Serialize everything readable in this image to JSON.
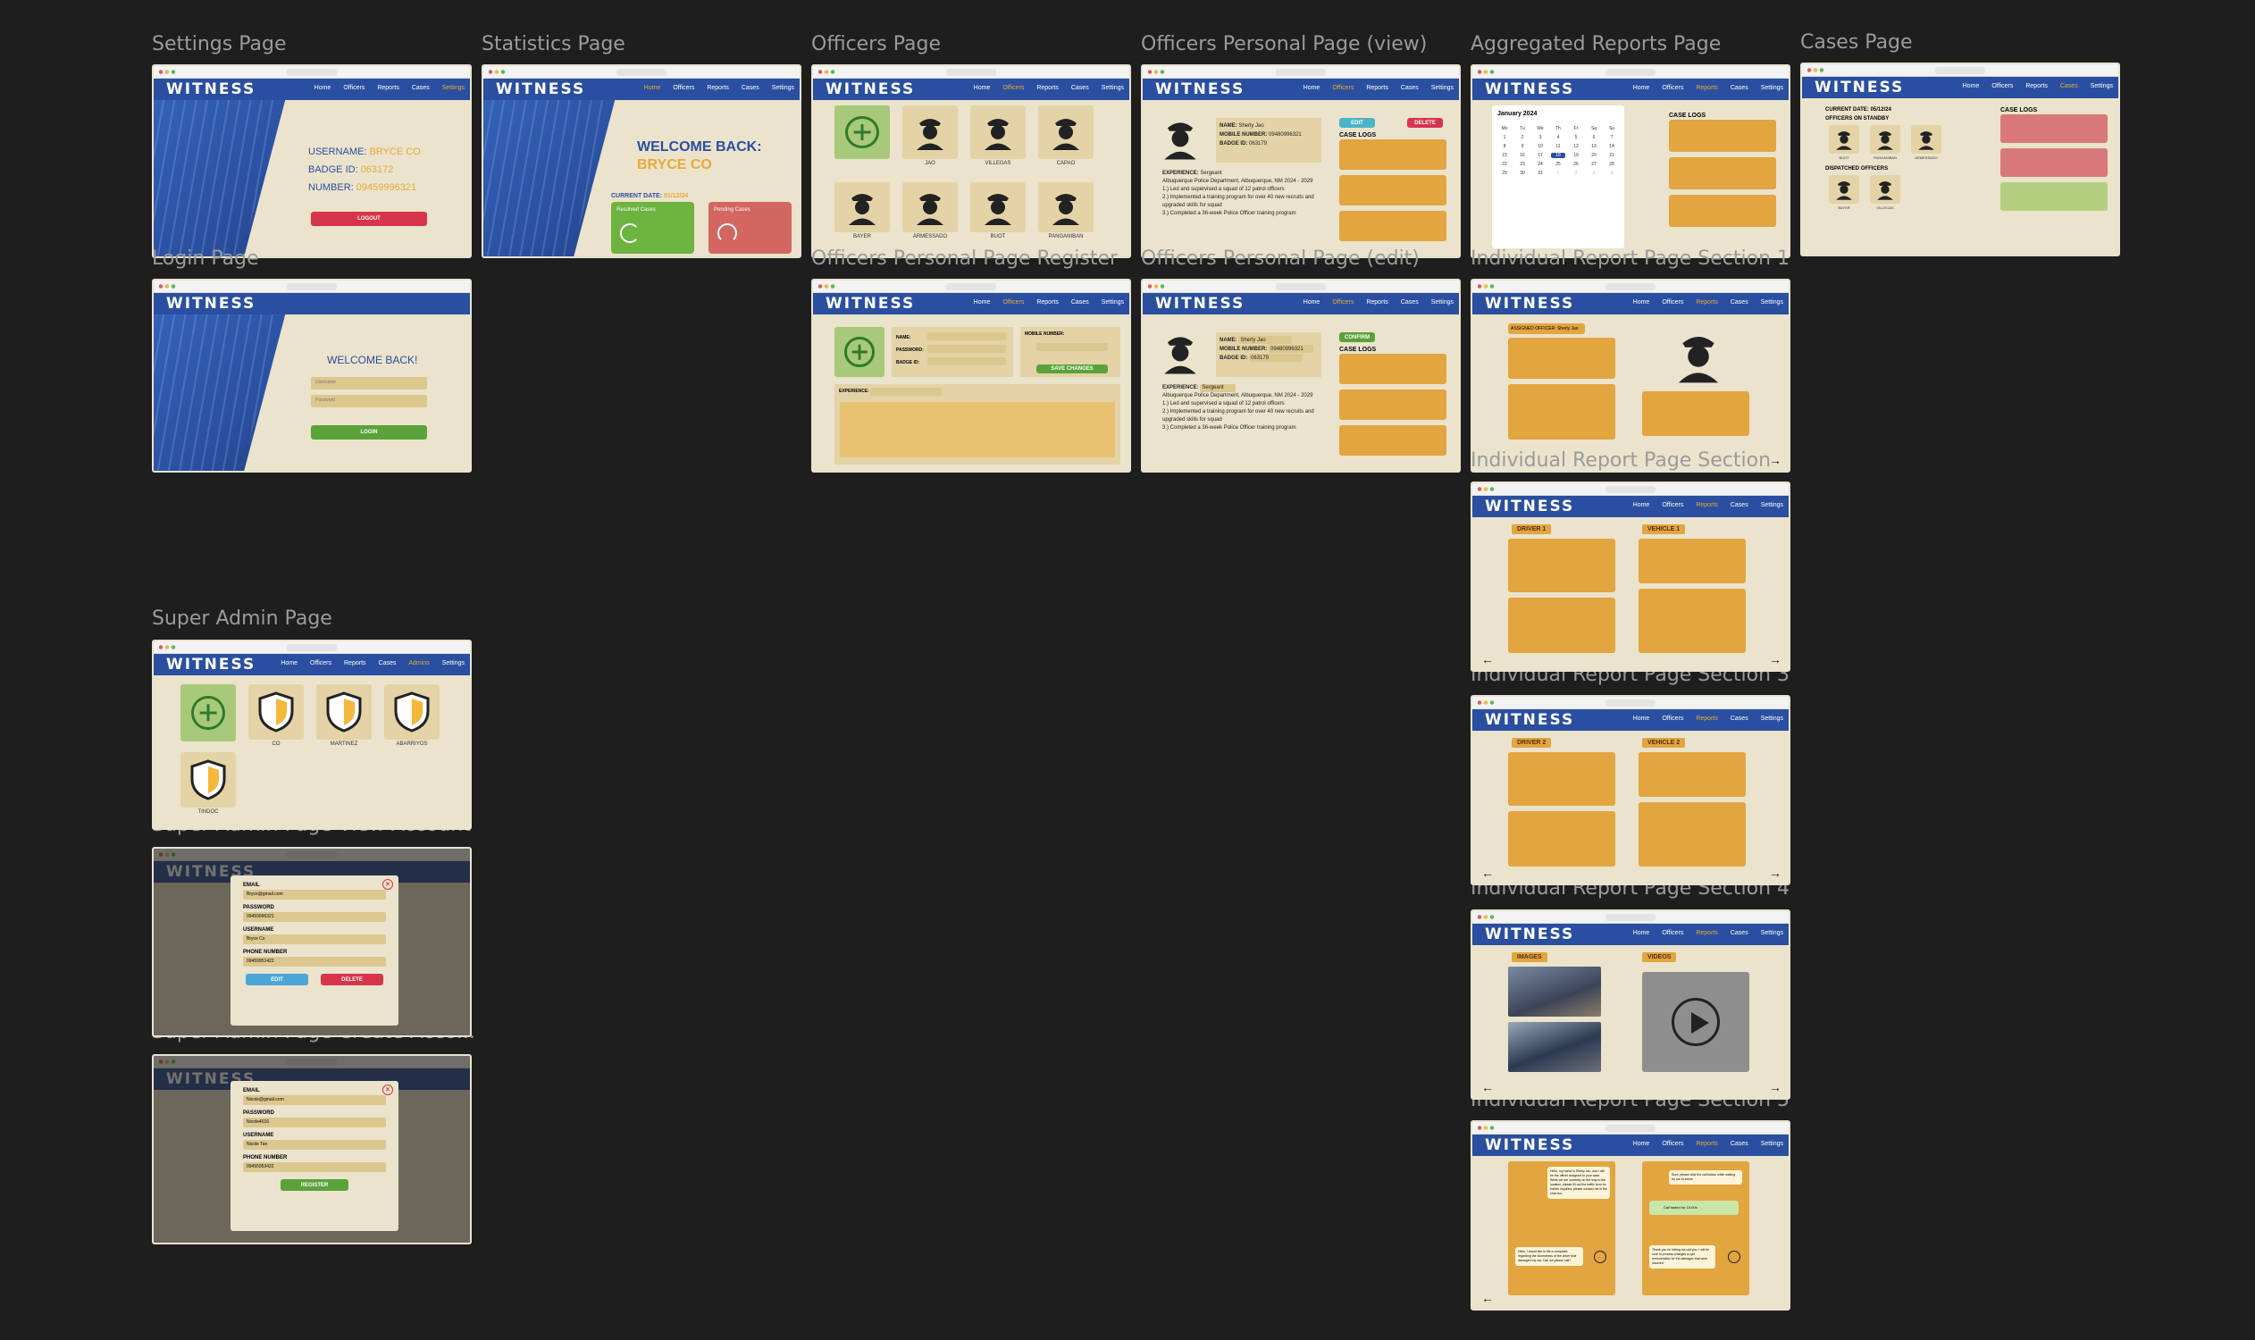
{
  "brand": {
    "logo": "WITNESS",
    "blue": "#2a4fa0",
    "accent": "#e9a93a",
    "beige": "#ebe3cc",
    "orange": "#e2a53f",
    "green": "#5aa23a",
    "red": "#d7354b"
  },
  "nav": {
    "home": "Home",
    "officers": "Officers",
    "reports": "Reports",
    "cases": "Cases",
    "settings": "Settings",
    "admins": "Admins"
  },
  "frames": {
    "settings": {
      "label": "Settings Page",
      "username_label": "USERNAME:",
      "username": "BRYCE CO",
      "badge_label": "BADGE ID:",
      "badge": "063172",
      "number_label": "NUMBER:",
      "number": "09459996321",
      "logout": "LOGOUT"
    },
    "statistics": {
      "label": "Statistics Page",
      "welcome": "WELCOME BACK:",
      "name": "BRYCE CO",
      "current_date_label": "CURRENT DATE:",
      "current_date": "01/12/24",
      "resolved": "Resolved Cases",
      "pending": "Pending Cases"
    },
    "officers": {
      "label": "Officers Page",
      "names": [
        "JAO",
        "VILLEGAS",
        "CAPAO",
        "BAYER",
        "ARMESSADO",
        "BUOT",
        "PANGANIBAN"
      ]
    },
    "officer_view": {
      "label": "Officers Personal Page (view)",
      "name_label": "NAME:",
      "name": "Sherly Jao",
      "mobile_label": "MOBILE NUMBER:",
      "mobile": "09480996321",
      "badge_label": "BADGE ID:",
      "badge": "063179",
      "edit": "EDIT",
      "delete": "DELETE",
      "case_logs": "CASE LOGS",
      "experience_label": "EXPERIENCE:",
      "rank": "Sergeant",
      "experience": "Albuquerque Police Department, Albuquerque, NM 2024 - 2029",
      "exp_lines": [
        "1.) Led and supervised a squad of 12 patrol officers",
        "2.) Implemented a training program for over 40 new recruits and upgraded skills for squad",
        "3.) Completed a 36-week Police Officer training program"
      ]
    },
    "aggregated": {
      "label": "Aggregated Reports Page",
      "month": "January 2024",
      "case_logs": "CASE LOGS",
      "selected_day": "18"
    },
    "cases": {
      "label": "Cases Page",
      "current_date_label": "CURRENT DATE:",
      "current_date": "05/12/24",
      "standby": "OFFICERS ON STANDBY",
      "dispatched": "DISPATCHED OFFICERS",
      "case_logs": "CASE LOGS",
      "standby_names": [
        "BUOT",
        "PANGANIBAN",
        "ARMESSADO"
      ],
      "dispatched_names": [
        "BAYER",
        "VILLEGAS"
      ]
    },
    "login": {
      "label": "Login Page",
      "welcome": "WELCOME BACK!",
      "username_ph": "Username",
      "password_ph": "Password",
      "login": "LOGIN"
    },
    "officer_register": {
      "label": "Officers Personal Page Register",
      "name_label": "NAME:",
      "password_label": "PASSWORD:",
      "badge_label": "BADGE ID:",
      "mobile_label": "MOBILE NUMBER:",
      "save": "SAVE CHANGES",
      "experience_label": "EXPERIENCE:"
    },
    "officer_edit": {
      "label": "Officers Personal Page (edit)",
      "confirm": "CONFIRM",
      "name": "Sherly Jao",
      "mobile": "09480996321",
      "badge": "063179",
      "rank": "Sergeant"
    },
    "report1": {
      "label": "Individual Report Page Section 1",
      "assigned": "ASSIGNED OFFICER: Sherly Jao"
    },
    "report2": {
      "label": "Individual Report Page Section 2",
      "driver": "DRIVER 1",
      "vehicle": "VEHICLE 1"
    },
    "report3": {
      "label": "Individual Report Page Section 3",
      "driver": "DRIVER 2",
      "vehicle": "VEHICLE 2"
    },
    "report4": {
      "label": "Individual Report Page Section 4",
      "images": "IMAGES",
      "videos": "VIDEOS"
    },
    "report5": {
      "label": "Individual Report Page Section 5",
      "msg1": "Hello, my name is Sherly Jao, and I will be the officer assigned to your case. While we are currently on the way to the location, please fill out the traffic form for further inquiries, please contact me in the chat box.",
      "msg2": "Sure, please click the call button while waiting for me to arrive.",
      "call": "Call lasted for 15:00s",
      "msg3": "Hello, I would like to file a complaint regarding the clumsiness of the driver that damaged my car. Can we please call?",
      "msg4": "Thank you for letting me call you, I will be sure to process changes to get remuneration for the damages that were incurred."
    },
    "superadmin": {
      "label": "Super Admin Page",
      "names": [
        "CO",
        "MARTINEZ",
        "ABARRIYOS",
        "TINDOC"
      ]
    },
    "superadmin_view": {
      "label": "Super Admin Page View Account",
      "email_label": "EMAIL",
      "email": "Bryce@gmail.com",
      "password_label": "PASSWORD",
      "password": "09459996321",
      "username_label": "USERNAME",
      "username": "Bryce Co",
      "phone_label": "PHONE NUMBER",
      "phone": "09459951422",
      "edit": "EDIT",
      "delete": "DELETE"
    },
    "superadmin_create": {
      "label": "Super Admin Page Create Acco...",
      "email_label": "EMAIL",
      "email": "Nicole@gmail.com",
      "password_label": "PASSWORD",
      "password": "Nicole4616",
      "username_label": "USERNAME",
      "username": "Nicole Tan",
      "phone_label": "PHONE NUMBER",
      "phone": "09455953422",
      "register": "REGISTER"
    }
  }
}
